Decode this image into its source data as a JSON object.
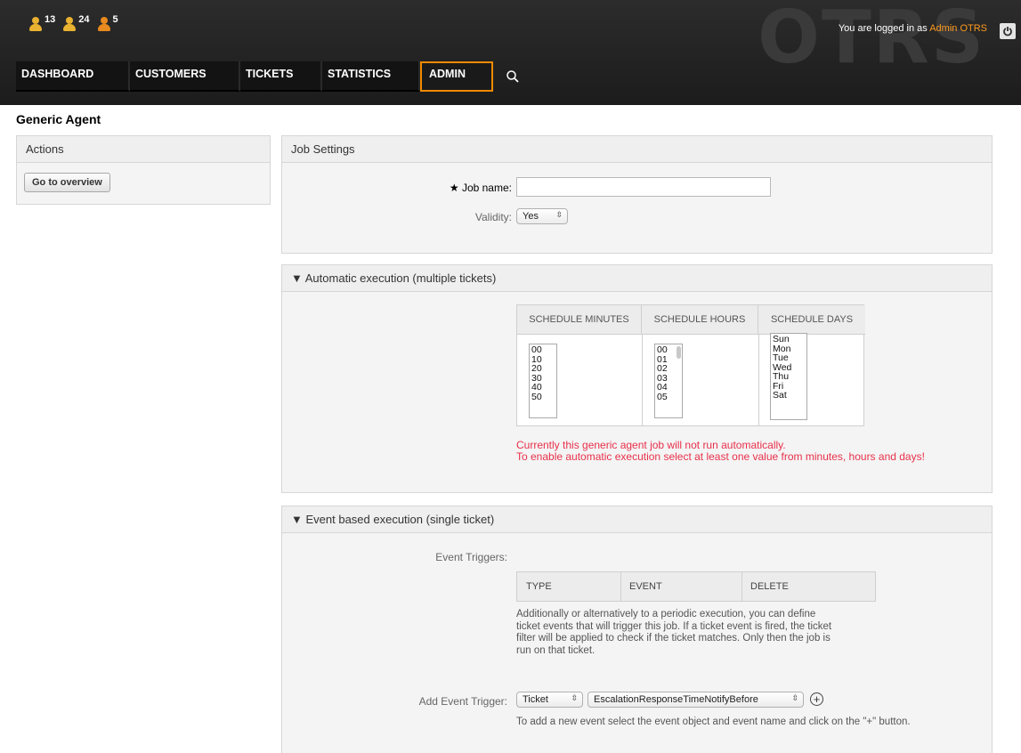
{
  "header": {
    "logo_text": "OTRS",
    "toolbar": [
      {
        "icon": "escalated-tickets-icon",
        "count": "13"
      },
      {
        "icon": "new-tickets-icon",
        "count": "24"
      },
      {
        "icon": "locked-tickets-icon",
        "count": "5"
      }
    ],
    "login_prefix": "You are logged in as",
    "login_user": "Admin OTRS",
    "nav": [
      "DASHBOARD",
      "CUSTOMERS",
      "TICKETS",
      "STATISTICS",
      "ADMIN"
    ],
    "active_nav": "ADMIN"
  },
  "page_title": "Generic Agent",
  "sidebar": {
    "title": "Actions",
    "button": "Go to overview"
  },
  "job_settings": {
    "title": "Job Settings",
    "required_marker": "★",
    "job_name_label": "Job name:",
    "job_name_value": "",
    "validity_label": "Validity:",
    "validity_value": "Yes"
  },
  "auto_exec": {
    "title": "▼ Automatic execution (multiple tickets)",
    "col_minutes": "SCHEDULE MINUTES",
    "col_hours": "SCHEDULE HOURS",
    "col_days": "SCHEDULE DAYS",
    "minutes": [
      "00",
      "10",
      "20",
      "30",
      "40",
      "50"
    ],
    "hours": [
      "00",
      "01",
      "02",
      "03",
      "04",
      "05"
    ],
    "days": [
      "Sun",
      "Mon",
      "Tue",
      "Wed",
      "Thu",
      "Fri",
      "Sat"
    ],
    "warning_line1": "Currently this generic agent job will not run automatically.",
    "warning_line2": "To enable automatic execution select at least one value from minutes, hours and days!"
  },
  "event_exec": {
    "title": "▼ Event based execution (single ticket)",
    "triggers_label": "Event Triggers:",
    "col_type": "TYPE",
    "col_event": "EVENT",
    "col_delete": "DELETE",
    "description_lines": [
      "Additionally or alternatively to a periodic execution, you can define",
      "ticket events that will trigger this job. If a ticket event is fired, the ticket",
      "filter will be applied to check if the ticket matches. Only then the job is",
      "run on that ticket."
    ],
    "add_label": "Add Event Trigger:",
    "object_value": "Ticket",
    "event_value": "EscalationResponseTimeNotifyBefore",
    "add_hint": "To add a new event select the event object and event name and click on the \"+\" button."
  },
  "colors": {
    "accent": "#f08a00",
    "warning": "#e8304a",
    "header_bg": "#222222"
  }
}
